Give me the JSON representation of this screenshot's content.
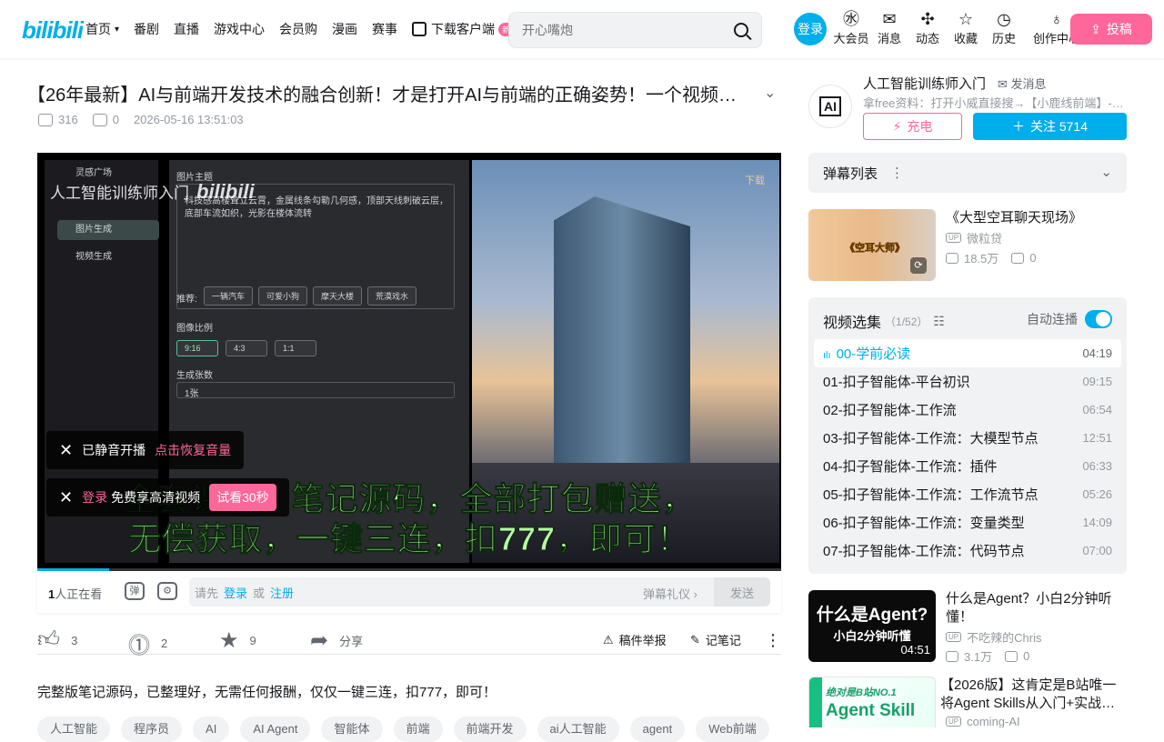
{
  "header": {
    "logo": "bilibili",
    "nav": [
      {
        "label": "首页",
        "has_dropdown": true
      },
      {
        "label": "番剧"
      },
      {
        "label": "直播"
      },
      {
        "label": "游戏中心"
      },
      {
        "label": "会员购"
      },
      {
        "label": "漫画"
      },
      {
        "label": "赛事"
      },
      {
        "label": "下载客户端",
        "badge": "新"
      }
    ],
    "search_placeholder": "开心嘴炮",
    "login": "登录",
    "icons": [
      {
        "label": "大会员",
        "icon": "vip-icon"
      },
      {
        "label": "消息",
        "icon": "message-icon"
      },
      {
        "label": "动态",
        "icon": "dynamic-icon"
      },
      {
        "label": "收藏",
        "icon": "star-icon"
      },
      {
        "label": "历史",
        "icon": "clock-icon"
      },
      {
        "label": "创作中心",
        "icon": "bulb-icon"
      }
    ],
    "upload": "投稿"
  },
  "video": {
    "title": "【26年最新】AI与前端开发技术的融合创新！才是打开AI与前端的正确姿势！一个视频…",
    "plays": "316",
    "danmaku": "0",
    "date": "2026-05-16 13:51:03"
  },
  "player": {
    "watermark": "人工智能训练师入门",
    "watermark_logo": "bilibili",
    "download_corner": "下载",
    "side_items": [
      "灵感广场",
      "图片生成",
      "视频生成"
    ],
    "panel_title": "图片主题",
    "panel_text": "科技感高楼耸立云霄，金属线条勾勒几何感，顶部天线刺破云层，底部车流如织，光影在楼体流转",
    "recommend_label": "推荐:",
    "recommend_chips": [
      "一辆汽车",
      "可爱小狗",
      "摩天大楼",
      "荒漠戏水"
    ],
    "ratio_label": "图像比例",
    "ratios": [
      "9:16",
      "4:3",
      "1:1"
    ],
    "count_label": "生成张数",
    "count_value": "1张",
    "subtitle_line1": "全套课程、笔记源码，全部打包赠送，",
    "subtitle_line2": "无偿获取，一键三连，扣777，即可！",
    "muted_text": "已静音开播",
    "muted_action": "点击恢复音量",
    "login_tip_login": "登录",
    "login_tip_text": "免费享高清视频",
    "trial_button": "试看30秒",
    "progress_fraction": 0.097
  },
  "danmaku_bar": {
    "viewers_count": "1",
    "viewers_suffix": "人正在看",
    "input_prefix": "请先",
    "login": "登录",
    "or": "或",
    "register": "注册",
    "etiquette": "弹幕礼仪",
    "send": "发送"
  },
  "actions": {
    "like": "3",
    "coin": "2",
    "favorite": "9",
    "share": "分享",
    "report": "稿件举报",
    "notes": "记笔记"
  },
  "description": "完整版笔记源码，已整理好，无需任何报酬，仅仅一键三连，扣777，即可！",
  "tags": [
    "人工智能",
    "程序员",
    "AI",
    "AI Agent",
    "智能体",
    "前端",
    "前端开发",
    "ai人工智能",
    "agent",
    "Web前端"
  ],
  "uploader": {
    "avatar_text": "AI",
    "name": "人工智能训练师入门",
    "message": "发消息",
    "desc": "拿free资料：打开小威直接搜→【小鹿线前端】-…",
    "charge": "充电",
    "follow": "关注 5714"
  },
  "danmaku_list": {
    "title": "弹幕列表"
  },
  "recommend_top": {
    "title": "《大型空耳聊天现场》",
    "thumb_text": "《空耳大师》",
    "up": "微粒贷",
    "plays": "18.5万",
    "danmaku": "0"
  },
  "playlist": {
    "title": "视频选集",
    "count": "（1/52）",
    "autoplay": "自动连播",
    "items": [
      {
        "title": "00-学前必读",
        "dur": "04:19",
        "active": true
      },
      {
        "title": "01-扣子智能体-平台初识",
        "dur": "09:15"
      },
      {
        "title": "02-扣子智能体-工作流",
        "dur": "06:54"
      },
      {
        "title": "03-扣子智能体-工作流：大模型节点",
        "dur": "12:51"
      },
      {
        "title": "04-扣子智能体-工作流：插件",
        "dur": "06:33"
      },
      {
        "title": "05-扣子智能体-工作流：工作流节点",
        "dur": "05:26"
      },
      {
        "title": "06-扣子智能体-工作流：变量类型",
        "dur": "14:09"
      },
      {
        "title": "07-扣子智能体-工作流：代码节点",
        "dur": "07:00"
      }
    ]
  },
  "recommend": [
    {
      "title": "什么是Agent？小白2分钟听懂！",
      "thumb_text": "什么是Agent?",
      "thumb_sub": "小白2分钟听懂",
      "dur": "04:51",
      "up": "不吃辣的Chris",
      "plays": "3.1万",
      "danmaku": "0"
    },
    {
      "title": "【2026版】这肯定是B站唯一将Agent Skills从入门+实战…",
      "thumb_text": "Agent Skill",
      "thumb_top": "绝对是B站NO.1",
      "up": "coming-AI"
    }
  ],
  "colors": {
    "accent": "#00aeec",
    "pink": "#ff6699"
  }
}
